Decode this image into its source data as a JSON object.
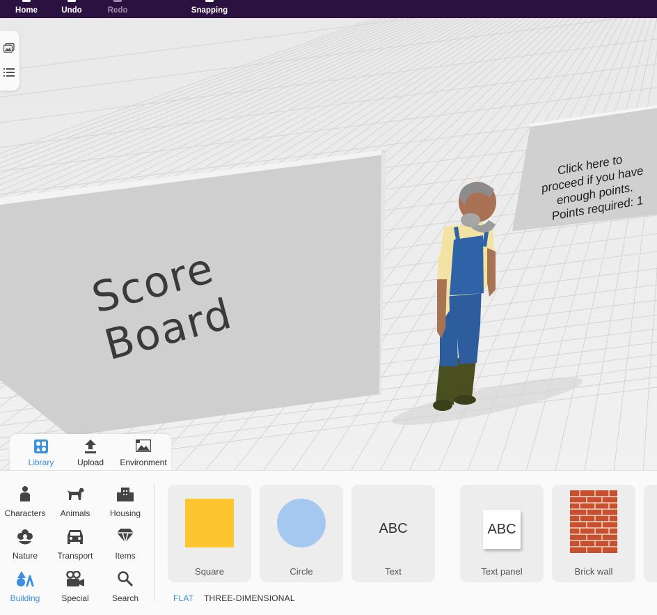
{
  "toolbar": {
    "home_label": "Home",
    "undo_label": "Undo",
    "redo_label": "Redo",
    "snapping_label": "Snapping"
  },
  "scene": {
    "score_board_text": "Score Board",
    "proceed_line1": "Click here to",
    "proceed_line2": "proceed if you have",
    "proceed_line3": "enough points.",
    "proceed_line4": "Points required: 1"
  },
  "side_panel": {
    "icons": [
      "gallery-icon",
      "list-icon"
    ]
  },
  "library_tabs": {
    "items": [
      {
        "label": "Library",
        "icon": "library-icon",
        "active": true
      },
      {
        "label": "Upload",
        "icon": "upload-icon",
        "active": false
      },
      {
        "label": "Environment",
        "icon": "environment-icon",
        "active": false
      }
    ]
  },
  "categories": {
    "items": [
      {
        "label": "Characters",
        "icon": "person-icon"
      },
      {
        "label": "Animals",
        "icon": "dog-icon"
      },
      {
        "label": "Housing",
        "icon": "building-icon"
      },
      {
        "label": "Nature",
        "icon": "flower-icon"
      },
      {
        "label": "Transport",
        "icon": "car-icon"
      },
      {
        "label": "Items",
        "icon": "gem-icon"
      },
      {
        "label": "Building",
        "icon": "shapes-icon",
        "active": true
      },
      {
        "label": "Special",
        "icon": "camera-icon"
      },
      {
        "label": "Search",
        "icon": "search-icon"
      }
    ]
  },
  "assets": {
    "items": [
      {
        "label": "Square",
        "color": "#fdc52f"
      },
      {
        "label": "Circle",
        "color": "#a4c8f0"
      },
      {
        "label": "Text",
        "thumb_text": "ABC"
      },
      {
        "label": "Text panel",
        "thumb_text": "ABC"
      },
      {
        "label": "Brick wall",
        "color": "#c8502e"
      }
    ]
  },
  "subtabs": {
    "flat_label": "FLAT",
    "three_d_label": "THREE-DIMENSIONAL"
  },
  "colors": {
    "accent": "#3a8fe0",
    "toolbar_bg": "#2a1140"
  }
}
